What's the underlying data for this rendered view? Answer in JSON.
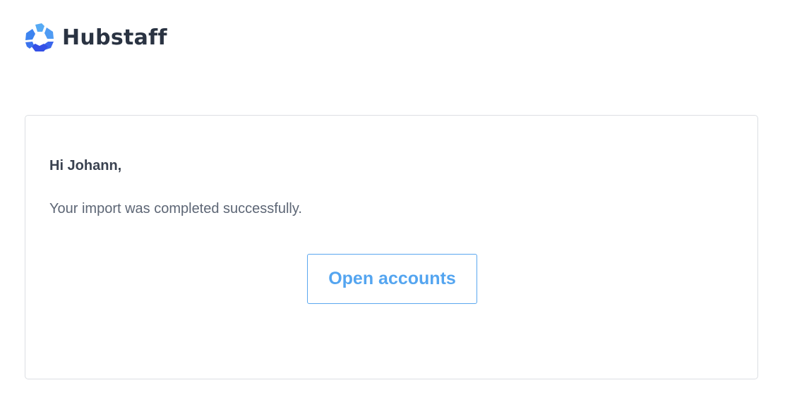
{
  "brand": {
    "name": "Hubstaff",
    "logo_icon": "hubstaff-logo-icon",
    "colors": {
      "light_blue": "#56aaf4",
      "mid_blue": "#3d7ff0",
      "dark_blue": "#3450e6",
      "text": "#2a3342"
    }
  },
  "email": {
    "greeting": "Hi Johann,",
    "message": "Your import was completed successfully.",
    "button_label": "Open accounts",
    "accent_color": "#54a5f0"
  }
}
